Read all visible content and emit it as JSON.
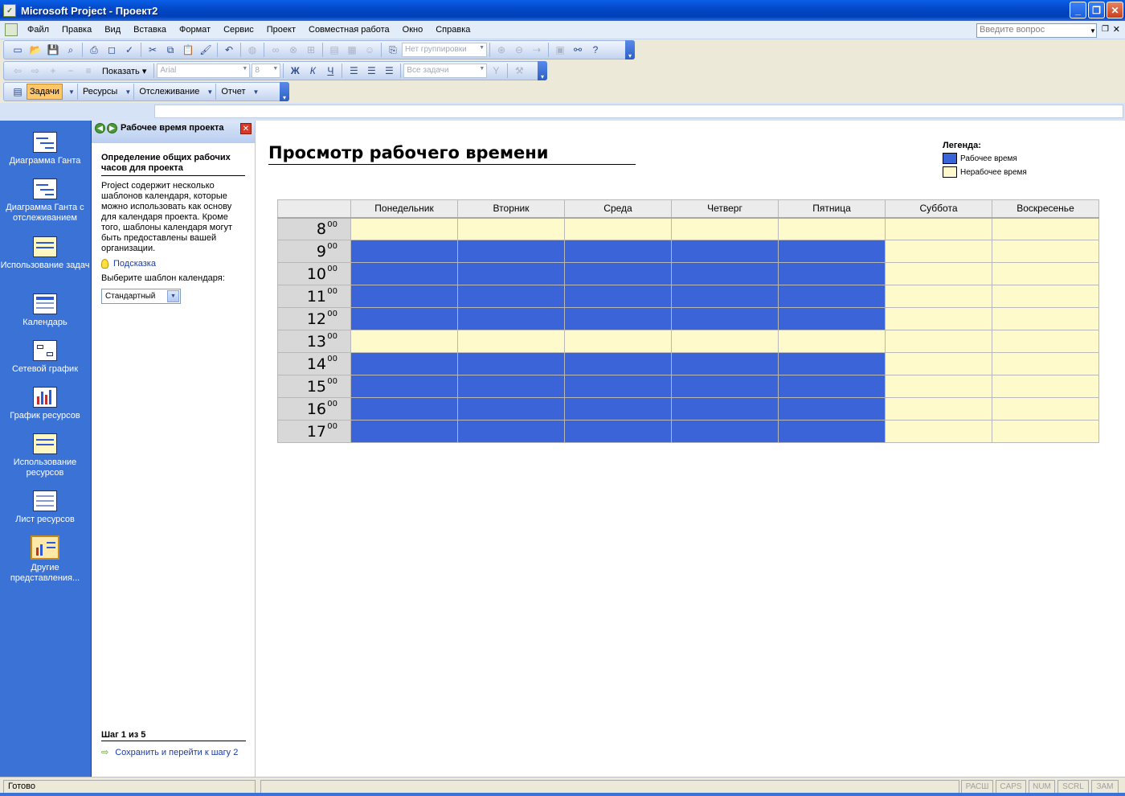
{
  "window": {
    "title": "Microsoft Project - Проект2"
  },
  "menu": {
    "items": [
      "Файл",
      "Правка",
      "Вид",
      "Вставка",
      "Формат",
      "Сервис",
      "Проект",
      "Совместная работа",
      "Окно",
      "Справка"
    ],
    "ask_placeholder": "Введите вопрос"
  },
  "toolbar": {
    "grouping": "Нет группировки",
    "show_label": "Показать",
    "font_name": "Arial",
    "font_size": "8",
    "bold": "Ж",
    "italic": "К",
    "underline": "Ч",
    "filter": "Все задачи"
  },
  "guide_bar": {
    "tasks": "Задачи",
    "resources": "Ресурсы",
    "tracking": "Отслеживание",
    "report": "Отчет"
  },
  "view_bar": {
    "items": [
      "Диаграмма Ганта",
      "Диаграмма Ганта с отслеживанием",
      "Использование задач",
      "Календарь",
      "Сетевой график",
      "График ресурсов",
      "Использование ресурсов",
      "Лист ресурсов",
      "Другие представления..."
    ]
  },
  "task_pane": {
    "title": "Рабочее время проекта",
    "heading": "Определение общих рабочих часов для проекта",
    "body": "Project содержит несколько шаблонов календаря, которые можно использовать как основу для календаря проекта. Кроме того, шаблоны календаря могут быть предоставлены вашей организации.",
    "hint_link": "Подсказка",
    "select_label": "Выберите шаблон календаря:",
    "select_value": "Стандартный",
    "step": "Шаг 1 из 5",
    "save_link": "Сохранить и перейти к шагу 2"
  },
  "main": {
    "title": "Просмотр рабочего времени",
    "legend": {
      "title": "Легенда:",
      "working": "Рабочее время",
      "nonworking": "Нерабочее время"
    },
    "days": [
      "Понедельник",
      "Вторник",
      "Среда",
      "Четверг",
      "Пятница",
      "Суббота",
      "Воскресенье"
    ],
    "hours": [
      "8",
      "9",
      "10",
      "11",
      "12",
      "13",
      "14",
      "15",
      "16",
      "17"
    ],
    "minutes_suffix": "00",
    "working_hours": [
      "9",
      "10",
      "11",
      "12",
      "14",
      "15",
      "16",
      "17"
    ],
    "working_days": [
      "Понедельник",
      "Вторник",
      "Среда",
      "Четверг",
      "Пятница"
    ],
    "colors": {
      "working": "#3a64d8",
      "nonworking": "#fefacb"
    }
  },
  "status": {
    "ready": "Готово",
    "indicators": [
      "РАСШ",
      "CAPS",
      "NUM",
      "SCRL",
      "ЗАМ"
    ]
  }
}
